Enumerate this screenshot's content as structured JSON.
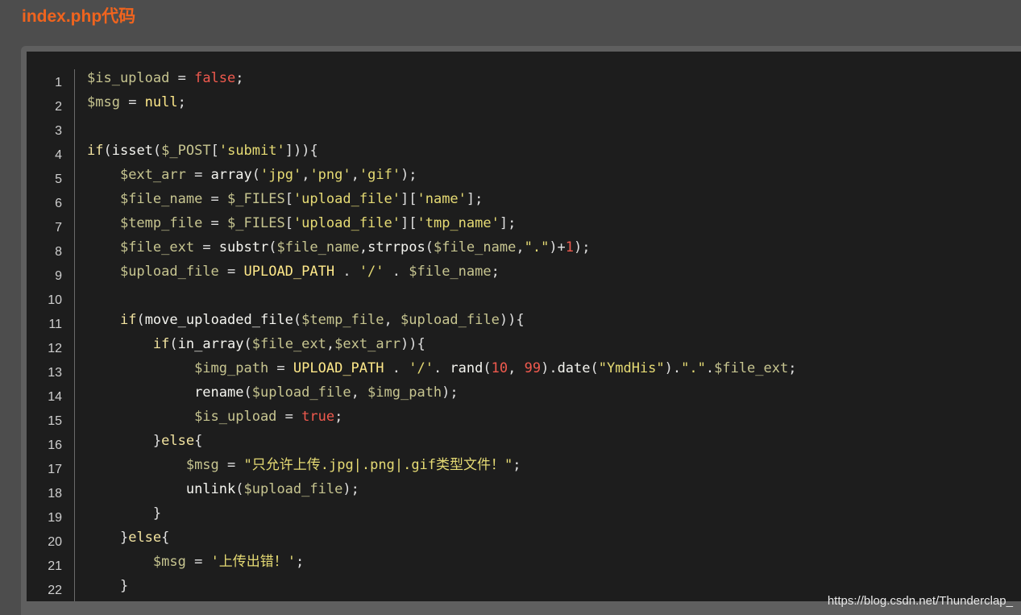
{
  "page": {
    "title": "index.php代码",
    "watermark": "https://blog.csdn.net/Thunderclap_"
  },
  "colors": {
    "title": "#f0641e",
    "panel_background": "#1d1d1d",
    "variable": "#c7c590",
    "string": "#e6db74",
    "boolean_number": "#f05a4e",
    "constant": "#ffe98a"
  },
  "code": {
    "language": "php",
    "lines": [
      {
        "number": "1",
        "tokens": [
          [
            "var",
            "$is_upload"
          ],
          [
            "op",
            " = "
          ],
          [
            "bool",
            "false"
          ],
          [
            "op",
            ";"
          ]
        ]
      },
      {
        "number": "2",
        "tokens": [
          [
            "var",
            "$msg"
          ],
          [
            "op",
            " = "
          ],
          [
            "const",
            "null"
          ],
          [
            "op",
            ";"
          ]
        ]
      },
      {
        "number": "3",
        "tokens": []
      },
      {
        "number": "4",
        "tokens": [
          [
            "kw",
            "if"
          ],
          [
            "op",
            "("
          ],
          [
            "fn",
            "isset"
          ],
          [
            "op",
            "("
          ],
          [
            "var",
            "$_POST"
          ],
          [
            "op",
            "["
          ],
          [
            "str",
            "'submit'"
          ],
          [
            "op",
            "])){"
          ]
        ]
      },
      {
        "number": "5",
        "tokens": [
          [
            "op",
            "    "
          ],
          [
            "var",
            "$ext_arr"
          ],
          [
            "op",
            " = "
          ],
          [
            "fn",
            "array"
          ],
          [
            "op",
            "("
          ],
          [
            "str",
            "'jpg'"
          ],
          [
            "op",
            ","
          ],
          [
            "str",
            "'png'"
          ],
          [
            "op",
            ","
          ],
          [
            "str",
            "'gif'"
          ],
          [
            "op",
            ");"
          ]
        ]
      },
      {
        "number": "6",
        "tokens": [
          [
            "op",
            "    "
          ],
          [
            "var",
            "$file_name"
          ],
          [
            "op",
            " = "
          ],
          [
            "var",
            "$_FILES"
          ],
          [
            "op",
            "["
          ],
          [
            "str",
            "'upload_file'"
          ],
          [
            "op",
            "]["
          ],
          [
            "str",
            "'name'"
          ],
          [
            "op",
            "];"
          ]
        ]
      },
      {
        "number": "7",
        "tokens": [
          [
            "op",
            "    "
          ],
          [
            "var",
            "$temp_file"
          ],
          [
            "op",
            " = "
          ],
          [
            "var",
            "$_FILES"
          ],
          [
            "op",
            "["
          ],
          [
            "str",
            "'upload_file'"
          ],
          [
            "op",
            "]["
          ],
          [
            "str",
            "'tmp_name'"
          ],
          [
            "op",
            "];"
          ]
        ]
      },
      {
        "number": "8",
        "tokens": [
          [
            "op",
            "    "
          ],
          [
            "var",
            "$file_ext"
          ],
          [
            "op",
            " = "
          ],
          [
            "fn",
            "substr"
          ],
          [
            "op",
            "("
          ],
          [
            "var",
            "$file_name"
          ],
          [
            "op",
            ","
          ],
          [
            "fn",
            "strrpos"
          ],
          [
            "op",
            "("
          ],
          [
            "var",
            "$file_name"
          ],
          [
            "op",
            ","
          ],
          [
            "str",
            "\".\""
          ],
          [
            "op",
            ")+"
          ],
          [
            "num",
            "1"
          ],
          [
            "op",
            ");"
          ]
        ]
      },
      {
        "number": "9",
        "tokens": [
          [
            "op",
            "    "
          ],
          [
            "var",
            "$upload_file"
          ],
          [
            "op",
            " = "
          ],
          [
            "const",
            "UPLOAD_PATH"
          ],
          [
            "op",
            " . "
          ],
          [
            "str",
            "'/'"
          ],
          [
            "op",
            " . "
          ],
          [
            "var",
            "$file_name"
          ],
          [
            "op",
            ";"
          ]
        ]
      },
      {
        "number": "10",
        "tokens": []
      },
      {
        "number": "11",
        "tokens": [
          [
            "op",
            "    "
          ],
          [
            "kw",
            "if"
          ],
          [
            "op",
            "("
          ],
          [
            "fn",
            "move_uploaded_file"
          ],
          [
            "op",
            "("
          ],
          [
            "var",
            "$temp_file"
          ],
          [
            "op",
            ", "
          ],
          [
            "var",
            "$upload_file"
          ],
          [
            "op",
            ")){"
          ]
        ]
      },
      {
        "number": "12",
        "tokens": [
          [
            "op",
            "        "
          ],
          [
            "kw",
            "if"
          ],
          [
            "op",
            "("
          ],
          [
            "fn",
            "in_array"
          ],
          [
            "op",
            "("
          ],
          [
            "var",
            "$file_ext"
          ],
          [
            "op",
            ","
          ],
          [
            "var",
            "$ext_arr"
          ],
          [
            "op",
            ")){"
          ]
        ]
      },
      {
        "number": "13",
        "tokens": [
          [
            "op",
            "             "
          ],
          [
            "var",
            "$img_path"
          ],
          [
            "op",
            " = "
          ],
          [
            "const",
            "UPLOAD_PATH"
          ],
          [
            "op",
            " . "
          ],
          [
            "str",
            "'/'"
          ],
          [
            "op",
            ". "
          ],
          [
            "fn",
            "rand"
          ],
          [
            "op",
            "("
          ],
          [
            "num",
            "10"
          ],
          [
            "op",
            ", "
          ],
          [
            "num",
            "99"
          ],
          [
            "op",
            ")."
          ],
          [
            "fn",
            "date"
          ],
          [
            "op",
            "("
          ],
          [
            "str",
            "\"YmdHis\""
          ],
          [
            "op",
            ")."
          ],
          [
            "str",
            "\".\""
          ],
          [
            "op",
            "."
          ],
          [
            "var",
            "$file_ext"
          ],
          [
            "op",
            ";"
          ]
        ]
      },
      {
        "number": "14",
        "tokens": [
          [
            "op",
            "             "
          ],
          [
            "fn",
            "rename"
          ],
          [
            "op",
            "("
          ],
          [
            "var",
            "$upload_file"
          ],
          [
            "op",
            ", "
          ],
          [
            "var",
            "$img_path"
          ],
          [
            "op",
            ");"
          ]
        ]
      },
      {
        "number": "15",
        "tokens": [
          [
            "op",
            "             "
          ],
          [
            "var",
            "$is_upload"
          ],
          [
            "op",
            " = "
          ],
          [
            "bool",
            "true"
          ],
          [
            "op",
            ";"
          ]
        ]
      },
      {
        "number": "16",
        "tokens": [
          [
            "op",
            "        "
          ],
          [
            "op",
            "}"
          ],
          [
            "kw",
            "else"
          ],
          [
            "op",
            "{"
          ]
        ]
      },
      {
        "number": "17",
        "tokens": [
          [
            "op",
            "            "
          ],
          [
            "var",
            "$msg"
          ],
          [
            "op",
            " = "
          ],
          [
            "str",
            "\"只允许上传.jpg|.png|.gif类型文件！\""
          ],
          [
            "op",
            ";"
          ]
        ]
      },
      {
        "number": "18",
        "tokens": [
          [
            "op",
            "            "
          ],
          [
            "fn",
            "unlink"
          ],
          [
            "op",
            "("
          ],
          [
            "var",
            "$upload_file"
          ],
          [
            "op",
            ");"
          ]
        ]
      },
      {
        "number": "19",
        "tokens": [
          [
            "op",
            "        "
          ],
          [
            "op",
            "}"
          ]
        ]
      },
      {
        "number": "20",
        "tokens": [
          [
            "op",
            "    "
          ],
          [
            "op",
            "}"
          ],
          [
            "kw",
            "else"
          ],
          [
            "op",
            "{"
          ]
        ]
      },
      {
        "number": "21",
        "tokens": [
          [
            "op",
            "        "
          ],
          [
            "var",
            "$msg"
          ],
          [
            "op",
            " = "
          ],
          [
            "str",
            "'上传出错！'"
          ],
          [
            "op",
            ";"
          ]
        ]
      },
      {
        "number": "22",
        "tokens": [
          [
            "op",
            "    "
          ],
          [
            "op",
            "}"
          ]
        ]
      }
    ]
  }
}
